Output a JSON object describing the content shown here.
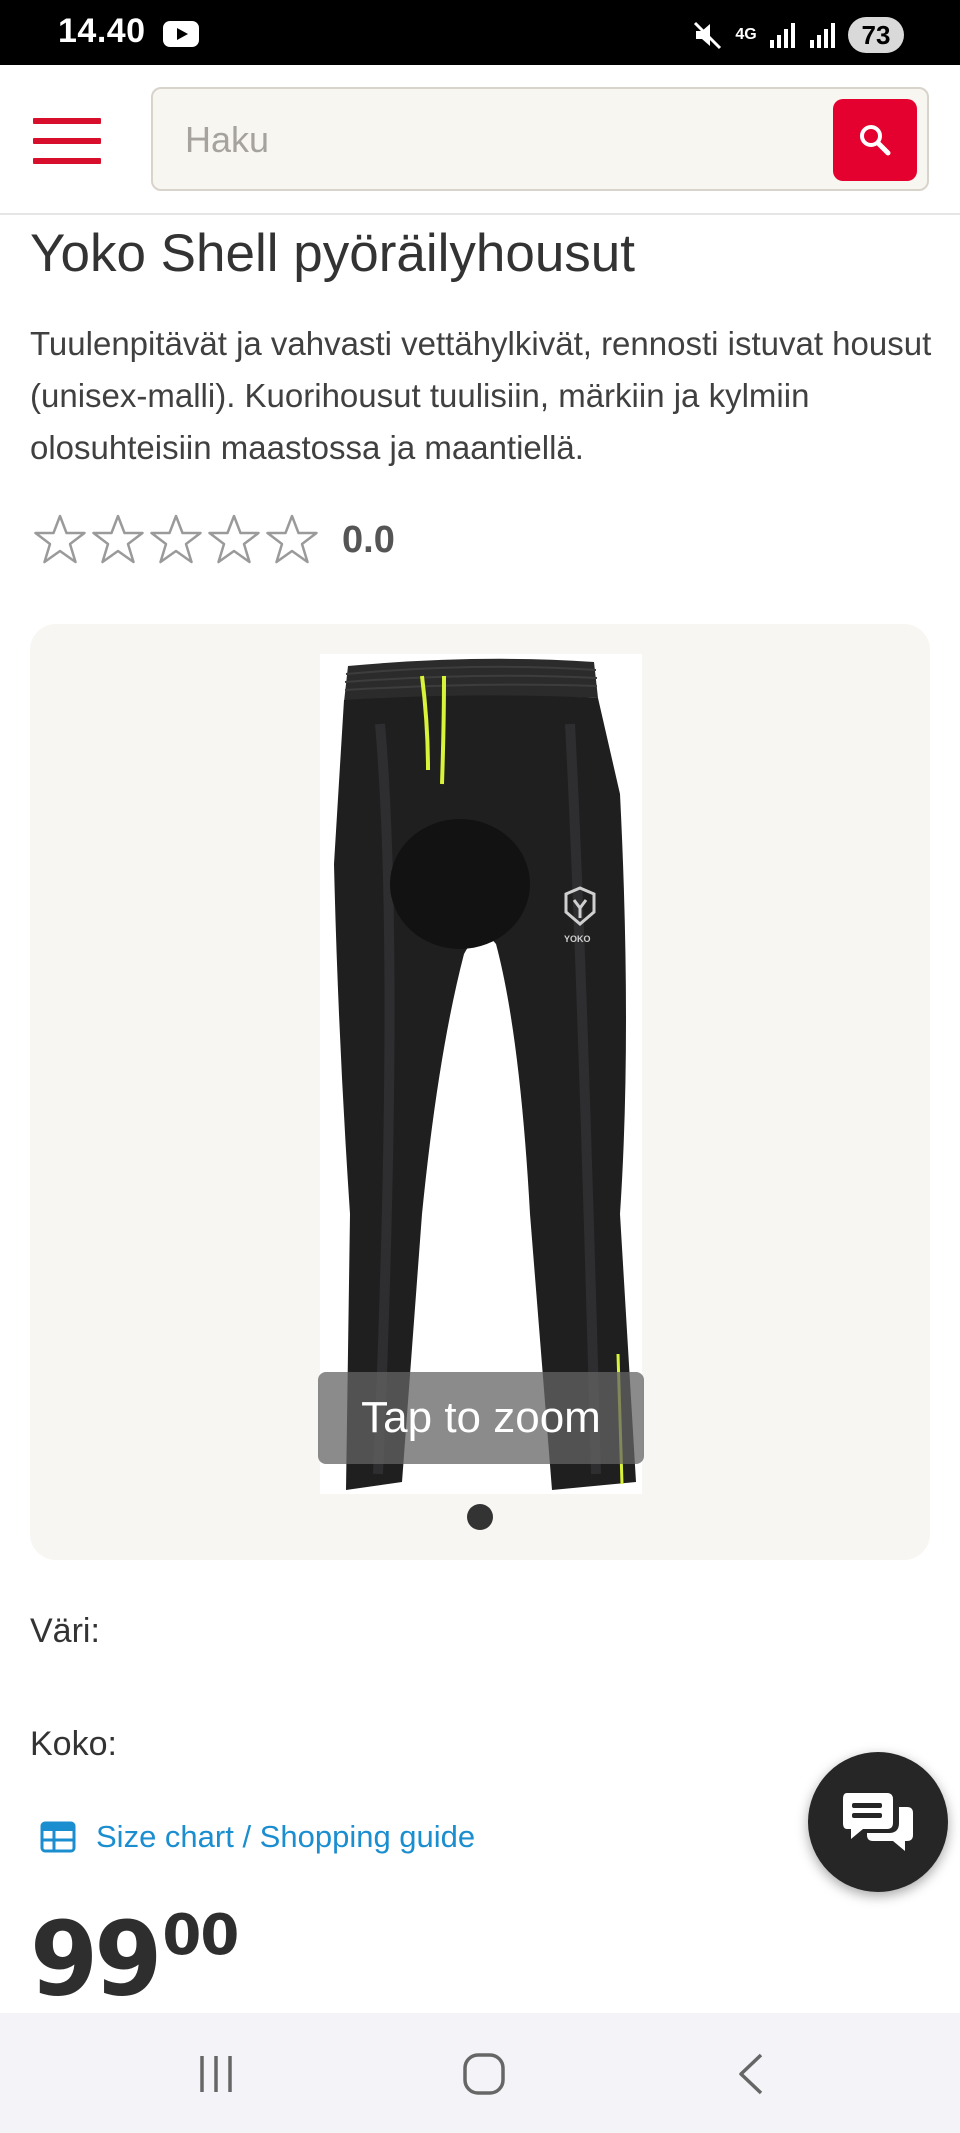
{
  "status_bar": {
    "time": "14.40",
    "network": "4G",
    "battery": "73"
  },
  "search": {
    "placeholder": "Haku"
  },
  "product": {
    "title": "Yoko Shell pyöräilyhousut",
    "description": "Tuulenpitävät ja vahvasti vettähylkivät, rennosti istuvat housut (unisex-malli). Kuorihousut tuulisiin, märkiin ja kylmiin olosuhteisiin maastossa ja maantiellä.",
    "rating_value": "0.0",
    "rating_stars_filled": 0,
    "rating_stars_total": 5,
    "image_brand_mark": "YOKO",
    "zoom_hint": "Tap to zoom",
    "gallery_images_count": 1,
    "color_label": "Väri:",
    "size_label": "Koko:",
    "size_guide_label": "Size chart / Shopping guide",
    "price_main": "99",
    "price_cents": "00"
  },
  "colors": {
    "brand_red": "#e4012f",
    "menu_red": "#d80f2c",
    "link_blue": "#1b8ed0",
    "chat_bg": "#262626"
  }
}
